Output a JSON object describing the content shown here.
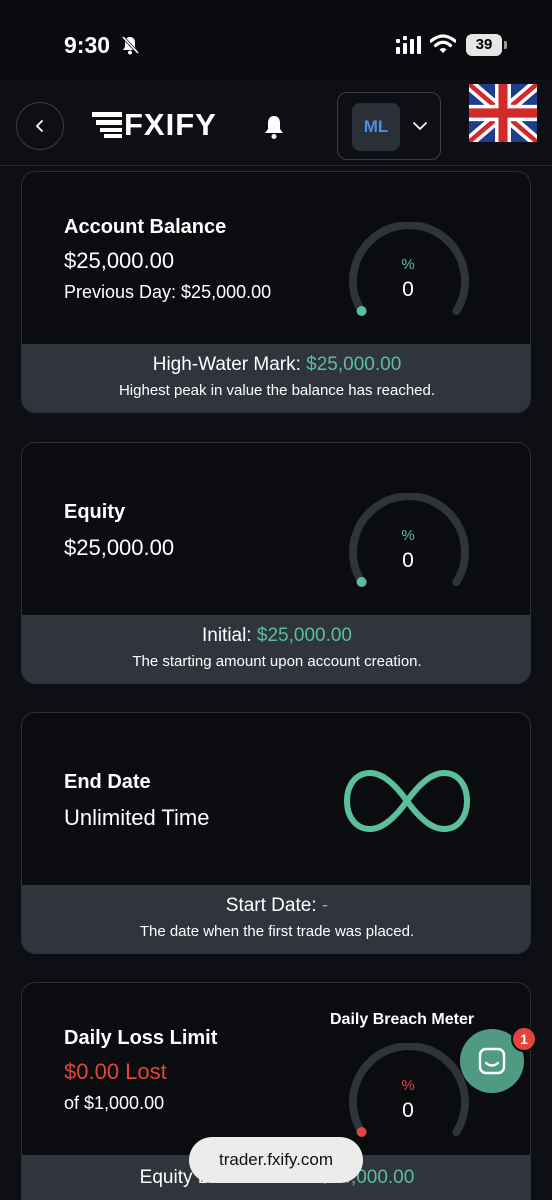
{
  "status": {
    "time": "9:30",
    "battery": "39"
  },
  "header": {
    "logo_text": "FXIFY",
    "account_initials": "ML"
  },
  "cards": {
    "balance": {
      "title": "Account Balance",
      "value": "$25,000.00",
      "previous_day": "Previous Day: $25,000.00",
      "gauge_label": "%",
      "gauge_value": "0",
      "footer_label": "High-Water Mark: ",
      "footer_value": "$25,000.00",
      "footer_note": "Highest peak in value the balance has reached."
    },
    "equity": {
      "title": "Equity",
      "value": "$25,000.00",
      "gauge_label": "%",
      "gauge_value": "0",
      "footer_label": "Initial: ",
      "footer_value": "$25,000.00",
      "footer_note": "The starting amount upon account creation."
    },
    "end_date": {
      "title": "End Date",
      "value": "Unlimited Time",
      "footer_label": "Start Date: ",
      "footer_value": "-",
      "footer_note": "The date when the first trade was placed."
    },
    "daily_loss": {
      "title": "Daily Loss Limit",
      "value": "$0.00 Lost",
      "sub": "of $1,000.00",
      "meter_title": "Daily Breach Meter",
      "gauge_label": "%",
      "gauge_value": "0",
      "footer_label": "Equity Breach Level: ",
      "footer_value": "$24,000.00"
    }
  },
  "browser": {
    "url": "trader.fxify.com"
  },
  "chat": {
    "badge_count": "1"
  },
  "colors": {
    "accent": "#5bbf9c",
    "danger": "#e0463c",
    "card_footer": "#30343c"
  }
}
